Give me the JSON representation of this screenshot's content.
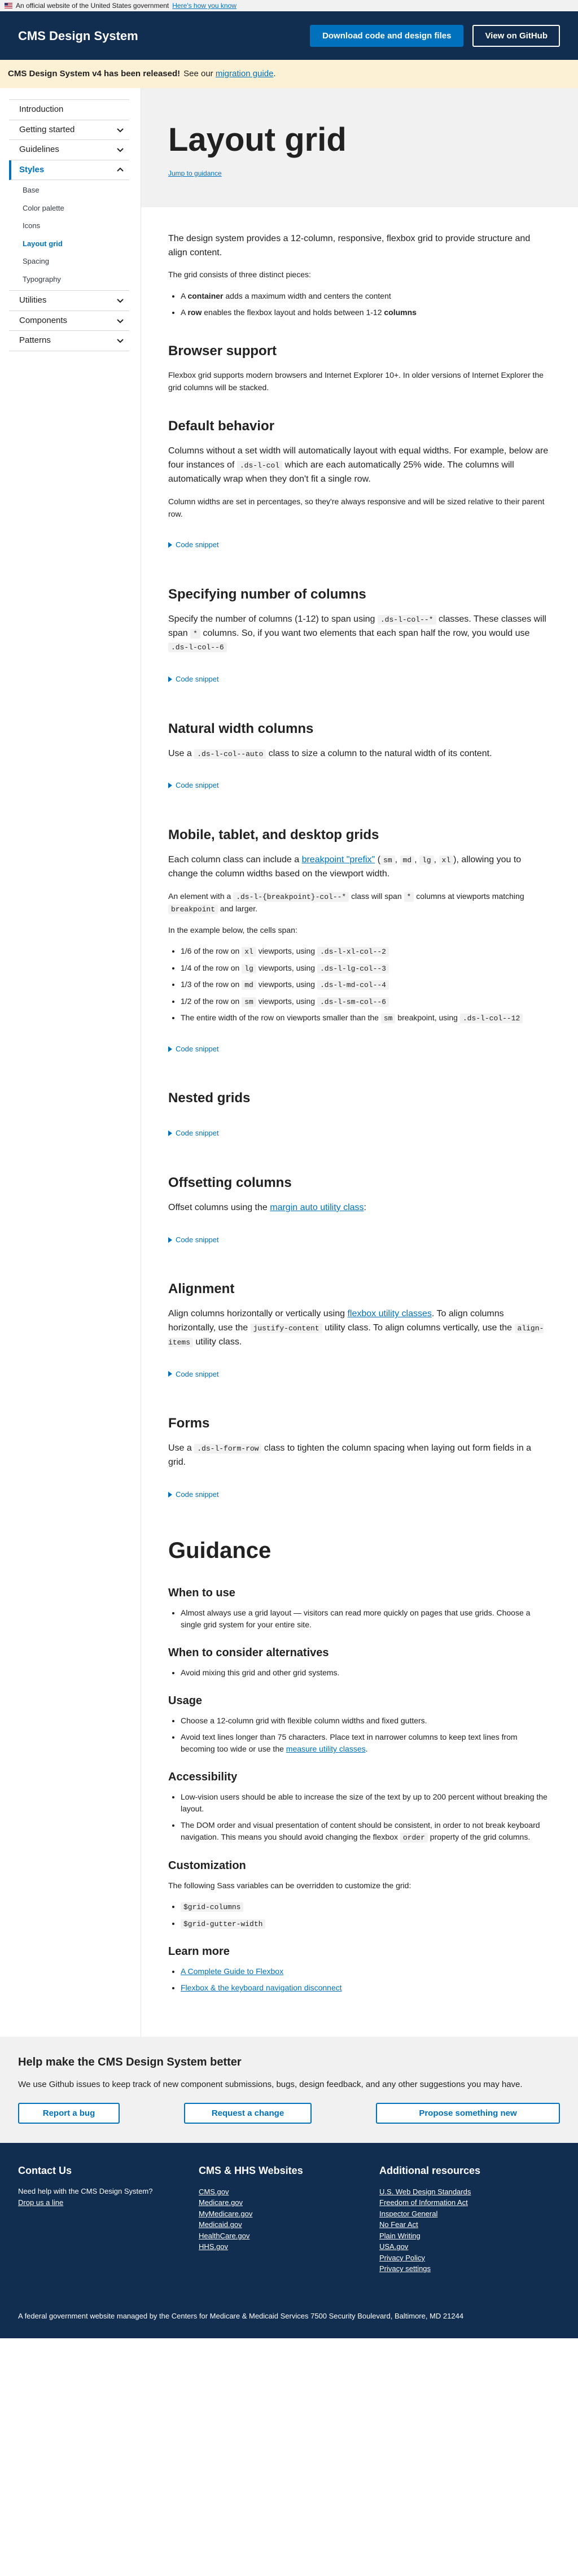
{
  "usa_banner": {
    "text": "An official website of the United States government",
    "link": "Here's how you know"
  },
  "header": {
    "logo": "CMS Design System",
    "download": "Download code and design files",
    "github": "View on GitHub"
  },
  "alert": {
    "bold": "CMS Design System v4 has been released!",
    "text": "See our",
    "link": "migration guide",
    "end": "."
  },
  "sidebar": {
    "items_before": [
      "Introduction",
      "Getting started",
      "Guidelines"
    ],
    "styles_label": "Styles",
    "styles_children": [
      "Base",
      "Color palette",
      "Icons",
      "Layout grid",
      "Spacing",
      "Typography"
    ],
    "items_after": [
      "Utilities",
      "Components",
      "Patterns"
    ]
  },
  "hero": {
    "title": "Layout grid",
    "jump": "Jump to guidance"
  },
  "intro": {
    "p1": "The design system provides a 12-column, responsive, flexbox grid to provide structure and align content.",
    "p2": "The grid consists of three distinct pieces:",
    "li1a": "A",
    "li1b": "container",
    "li1c": "adds a maximum width and centers the content",
    "li2a": "A",
    "li2b": "row",
    "li2c": "enables the flexbox layout and holds between 1-12",
    "li2d": "columns"
  },
  "browser": {
    "title": "Browser support",
    "p": "Flexbox grid supports modern browsers and Internet Explorer 10+. In older versions of Internet Explorer the grid columns will be stacked."
  },
  "default": {
    "title": "Default behavior",
    "p1a": "Columns without a set width will automatically layout with equal widths. For example, below are four instances of",
    "p1code": ".ds-l-col",
    "p1b": "which are each automatically 25% wide. The columns will automatically wrap when they don't fit a single row.",
    "p2": "Column widths are set in percentages, so they're always responsive and will be sized relative to their parent row."
  },
  "snippet": "Code snippet",
  "specify": {
    "title": "Specifying number of columns",
    "a": "Specify the number of columns (1-12) to span using",
    "code1": ".ds-l-col--*",
    "b": "classes. These classes will span",
    "code2": "*",
    "c": "columns. So, if you want two elements that each span half the row, you would use",
    "code3": ".ds-l-col--6"
  },
  "natural": {
    "title": "Natural width columns",
    "a": "Use a",
    "code": ".ds-l-col--auto",
    "b": "class to size a column to the natural width of its content."
  },
  "mtd": {
    "title": "Mobile, tablet, and desktop grids",
    "p1a": "Each column class can include a",
    "p1link": "breakpoint \"prefix\"",
    "p1b": "(",
    "sm": "sm",
    "md": "md",
    "lg": "lg",
    "xl": "xl",
    "p1c": "), allowing you to change the column widths based on the viewport width.",
    "p2a": "An element with a",
    "p2code": ".ds-l-{breakpoint}-col--*",
    "p2b": "class will span",
    "p2code2": "*",
    "p2c": "columns at viewports matching",
    "p2code3": "breakpoint",
    "p2d": "and larger.",
    "p3": "In the example below, the cells span:",
    "li1a": "1/6 of the row on",
    "li1b": "viewports, using",
    "li1code": ".ds-l-xl-col--2",
    "li2a": "1/4 of the row on",
    "li2b": "viewports, using",
    "li2code": ".ds-l-lg-col--3",
    "li3a": "1/3 of the row on",
    "li3b": "viewports, using",
    "li3code": ".ds-l-md-col--4",
    "li4a": "1/2 of the row on",
    "li4b": "viewports, using",
    "li4code": ".ds-l-sm-col--6",
    "li5a": "The entire width of the row on viewports smaller than the",
    "li5b": "breakpoint, using",
    "li5code": ".ds-l-col--12"
  },
  "nested": {
    "title": "Nested grids"
  },
  "offset": {
    "title": "Offsetting columns",
    "a": "Offset columns using the",
    "link": "margin auto utility class",
    "b": ":"
  },
  "align": {
    "title": "Alignment",
    "a": "Align columns horizontally or vertically using",
    "link": "flexbox utility classes",
    "b": ". To align columns horizontally, use the",
    "code1": "justify-content",
    "c": "utility class. To align columns vertically, use the",
    "code2": "align-items",
    "d": "utility class."
  },
  "forms": {
    "title": "Forms",
    "a": "Use a",
    "code": ".ds-l-form-row",
    "b": "class to tighten the column spacing when laying out form fields in a grid."
  },
  "guidance": {
    "title": "Guidance",
    "when_title": "When to use",
    "when_li": "Almost always use a grid layout — visitors can read more quickly on pages that use grids. Choose a single grid system for your entire site.",
    "alt_title": "When to consider alternatives",
    "alt_li": "Avoid mixing this grid and other grid systems.",
    "usage_title": "Usage",
    "usage_li1": "Choose a 12-column grid with flexible column widths and fixed gutters.",
    "usage_li2a": "Avoid text lines longer than 75 characters. Place text in narrower columns to keep text lines from becoming too wide or use the",
    "usage_li2link": "measure utility classes",
    "usage_li2b": ".",
    "a11y_title": "Accessibility",
    "a11y_li1": "Low-vision users should be able to increase the size of the text by up to 200 percent without breaking the layout.",
    "a11y_li2a": "The DOM order and visual presentation of content should be consistent, in order to not break keyboard navigation. This means you should avoid changing the flexbox",
    "a11y_li2code": "order",
    "a11y_li2b": "property of the grid columns.",
    "custom_title": "Customization",
    "custom_p": "The following Sass variables can be overridden to customize the grid:",
    "custom_code1": "$grid-columns",
    "custom_code2": "$grid-gutter-width",
    "learn_title": "Learn more",
    "learn_link1": "A Complete Guide to Flexbox",
    "learn_link2": "Flexbox & the keyboard navigation disconnect"
  },
  "help": {
    "title": "Help make the CMS Design System better",
    "p": "We use Github issues to keep track of new component submissions, bugs, design feedback, and any other suggestions you may have.",
    "bug": "Report a bug",
    "change": "Request a change",
    "propose": "Propose something new"
  },
  "footer": {
    "contact_title": "Contact Us",
    "contact_text": "Need help with the CMS Design System?",
    "contact_link": "Drop us a line",
    "sites_title": "CMS & HHS Websites",
    "sites": [
      "CMS.gov",
      "Medicare.gov",
      "MyMedicare.gov",
      "Medicaid.gov",
      "HealthCare.gov",
      "HHS.gov"
    ],
    "resources_title": "Additional resources",
    "resources": [
      "U.S. Web Design Standards",
      "Freedom of Information Act",
      "Inspector General",
      "No Fear Act",
      "Plain Writing",
      "USA.gov",
      "Privacy Policy",
      "Privacy settings"
    ],
    "bottom": "A federal government website managed by the Centers for Medicare & Medicaid Services 7500 Security Boulevard, Baltimore, MD 21244"
  },
  "colors": {
    "header_bg": "#112e51",
    "accent": "#0071bc",
    "alert_bg": "#fdf1d5",
    "hero_bg": "#f1f1f1"
  }
}
